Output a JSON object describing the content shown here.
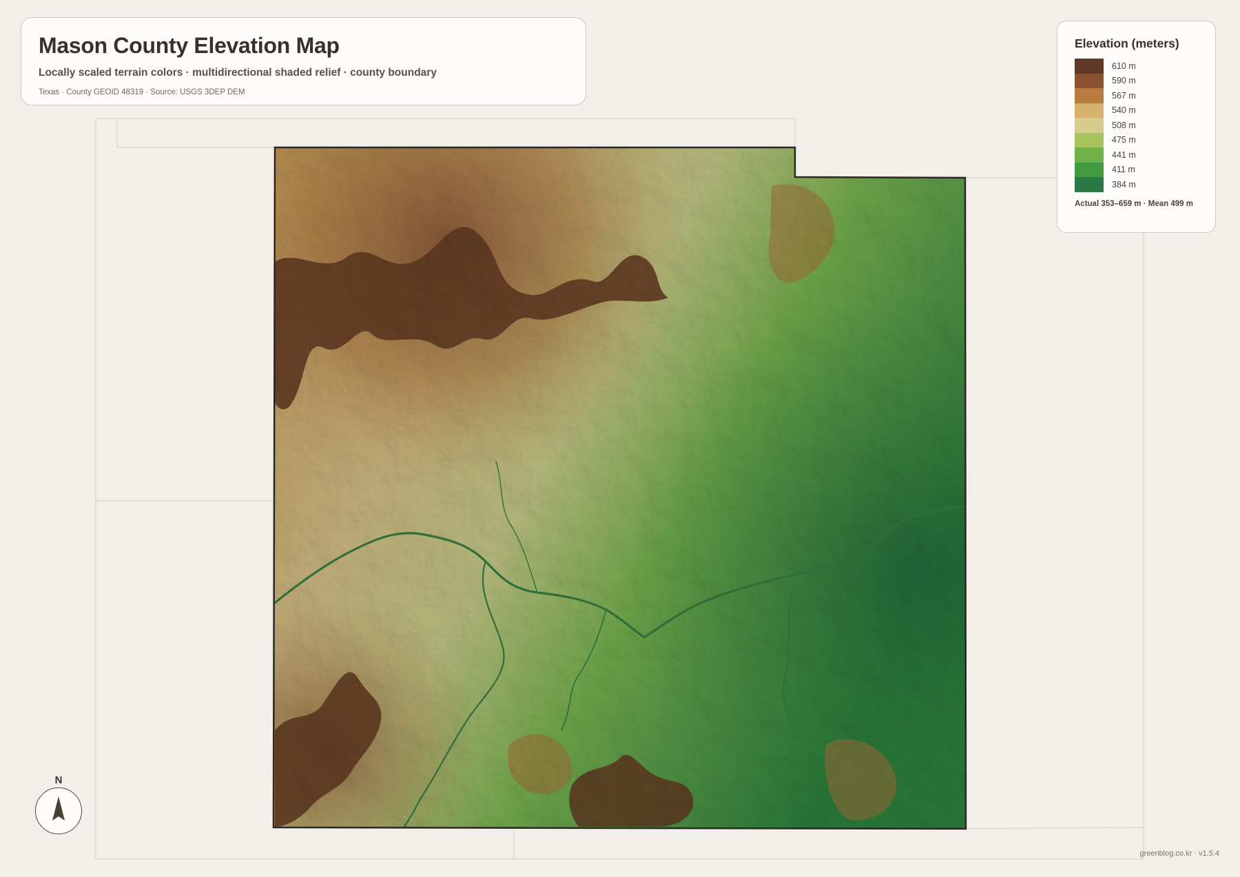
{
  "header": {
    "title": "Mason County Elevation Map",
    "subtitle": "Locally scaled terrain colors · multidirectional shaded relief · county boundary",
    "source": "Texas · County GEOID 48319 · Source: USGS 3DEP DEM"
  },
  "legend": {
    "title": "Elevation (meters)",
    "items": [
      {
        "label": "610 m",
        "color": "#5e3a24"
      },
      {
        "label": "590 m",
        "color": "#8b5230"
      },
      {
        "label": "567 m",
        "color": "#b97c3f"
      },
      {
        "label": "540 m",
        "color": "#d7b06c"
      },
      {
        "label": "508 m",
        "color": "#d6cb8b"
      },
      {
        "label": "475 m",
        "color": "#a9c35f"
      },
      {
        "label": "441 m",
        "color": "#6fb04b"
      },
      {
        "label": "411 m",
        "color": "#3f9a40"
      },
      {
        "label": "384 m",
        "color": "#2a7a45"
      }
    ],
    "stats": "Actual 353–659 m · Mean 499 m"
  },
  "north_arrow": {
    "label": "N",
    "icon": "north-arrow-icon"
  },
  "credit": "greenblog.co.kr · v1.5.4",
  "colors": {
    "background": "#f2efea",
    "card": "#fdfcfa",
    "card_border": "#cfc8bd",
    "neighbor_lines": "#d8d3cb",
    "boundary": "#2b2622",
    "river": "#2f6e3a"
  }
}
